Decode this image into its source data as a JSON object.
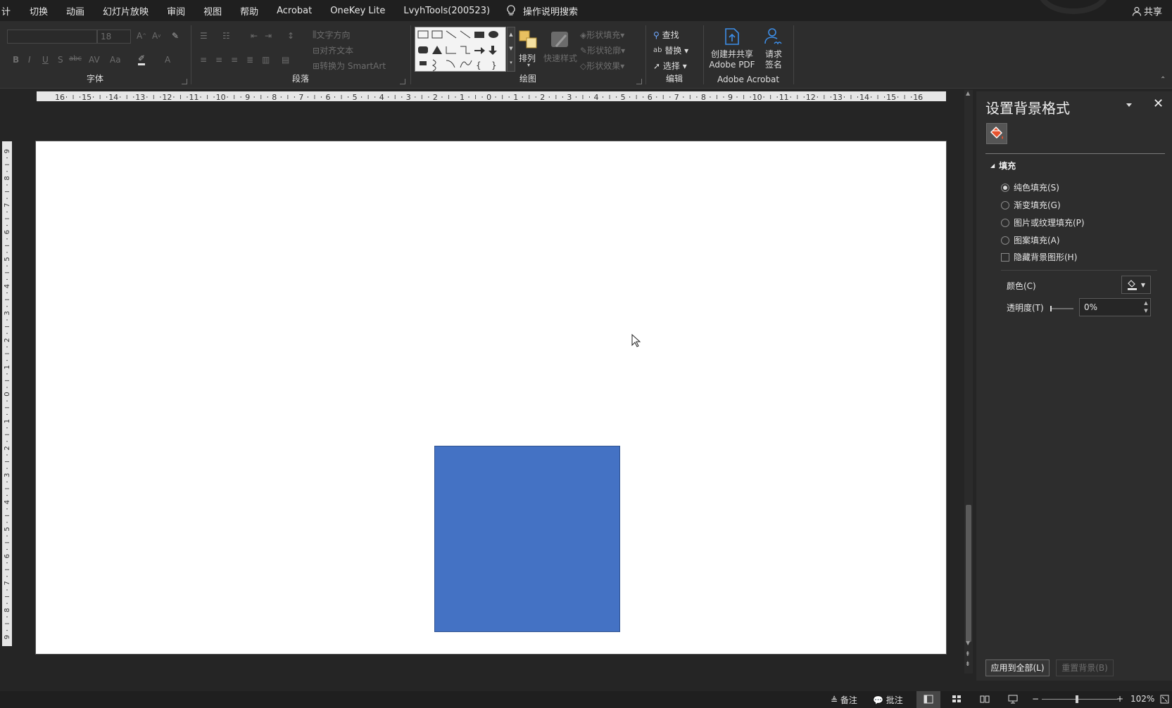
{
  "menu": {
    "items": [
      "计",
      "切换",
      "动画",
      "幻灯片放映",
      "审阅",
      "视图",
      "帮助",
      "Acrobat",
      "OneKey Lite",
      "LvyhTools(200523)"
    ],
    "search_label": "操作说明搜索",
    "share_label": "共享"
  },
  "ribbon": {
    "font": {
      "size_value": "18",
      "label": "字体"
    },
    "paragraph": {
      "text_direction": "文字方向",
      "align_text": "对齐文本",
      "convert_smartart": "转换为 SmartArt",
      "label": "段落"
    },
    "drawing": {
      "arrange": "排列",
      "quick_styles": "快速样式",
      "shape_fill": "形状填充",
      "shape_outline": "形状轮廓",
      "shape_effects": "形状效果",
      "label": "绘图"
    },
    "editing": {
      "find": "查找",
      "replace": "替换",
      "select": "选择",
      "label": "编辑"
    },
    "acrobat": {
      "create_share_line1": "创建并共享",
      "create_share_line2": "Adobe PDF",
      "request_sign_line1": "请求",
      "request_sign_line2": "签名",
      "label": "Adobe Acrobat"
    }
  },
  "ruler": {
    "h_ticks": [
      "16",
      "15",
      "14",
      "13",
      "12",
      "11",
      "10",
      "9",
      "8",
      "7",
      "6",
      "5",
      "4",
      "3",
      "2",
      "1",
      "0",
      "1",
      "2",
      "3",
      "4",
      "5",
      "6",
      "7",
      "8",
      "9",
      "10",
      "11",
      "12",
      "13",
      "14",
      "15",
      "16"
    ],
    "v_ticks": [
      "9",
      "8",
      "7",
      "6",
      "5",
      "4",
      "3",
      "2",
      "1",
      "0",
      "1",
      "2",
      "3",
      "4",
      "5",
      "6",
      "7",
      "8",
      "9"
    ]
  },
  "slide": {
    "shape_color": "#4472c4"
  },
  "pane": {
    "title": "设置背景格式",
    "section_fill": "填充",
    "options": [
      {
        "label": "纯色填充(S)",
        "selected": true
      },
      {
        "label": "渐变填充(G)",
        "selected": false
      },
      {
        "label": "图片或纹理填充(P)",
        "selected": false
      },
      {
        "label": "图案填充(A)",
        "selected": false
      }
    ],
    "hide_bg_graphics": "隐藏背景图形(H)",
    "color_label": "颜色(C)",
    "transparency_label": "透明度(T)",
    "transparency_value": "0%",
    "apply_all": "应用到全部(L)",
    "reset_bg": "重置背景(B)"
  },
  "status": {
    "notes": "备注",
    "comments": "批注",
    "zoom": "102%"
  }
}
